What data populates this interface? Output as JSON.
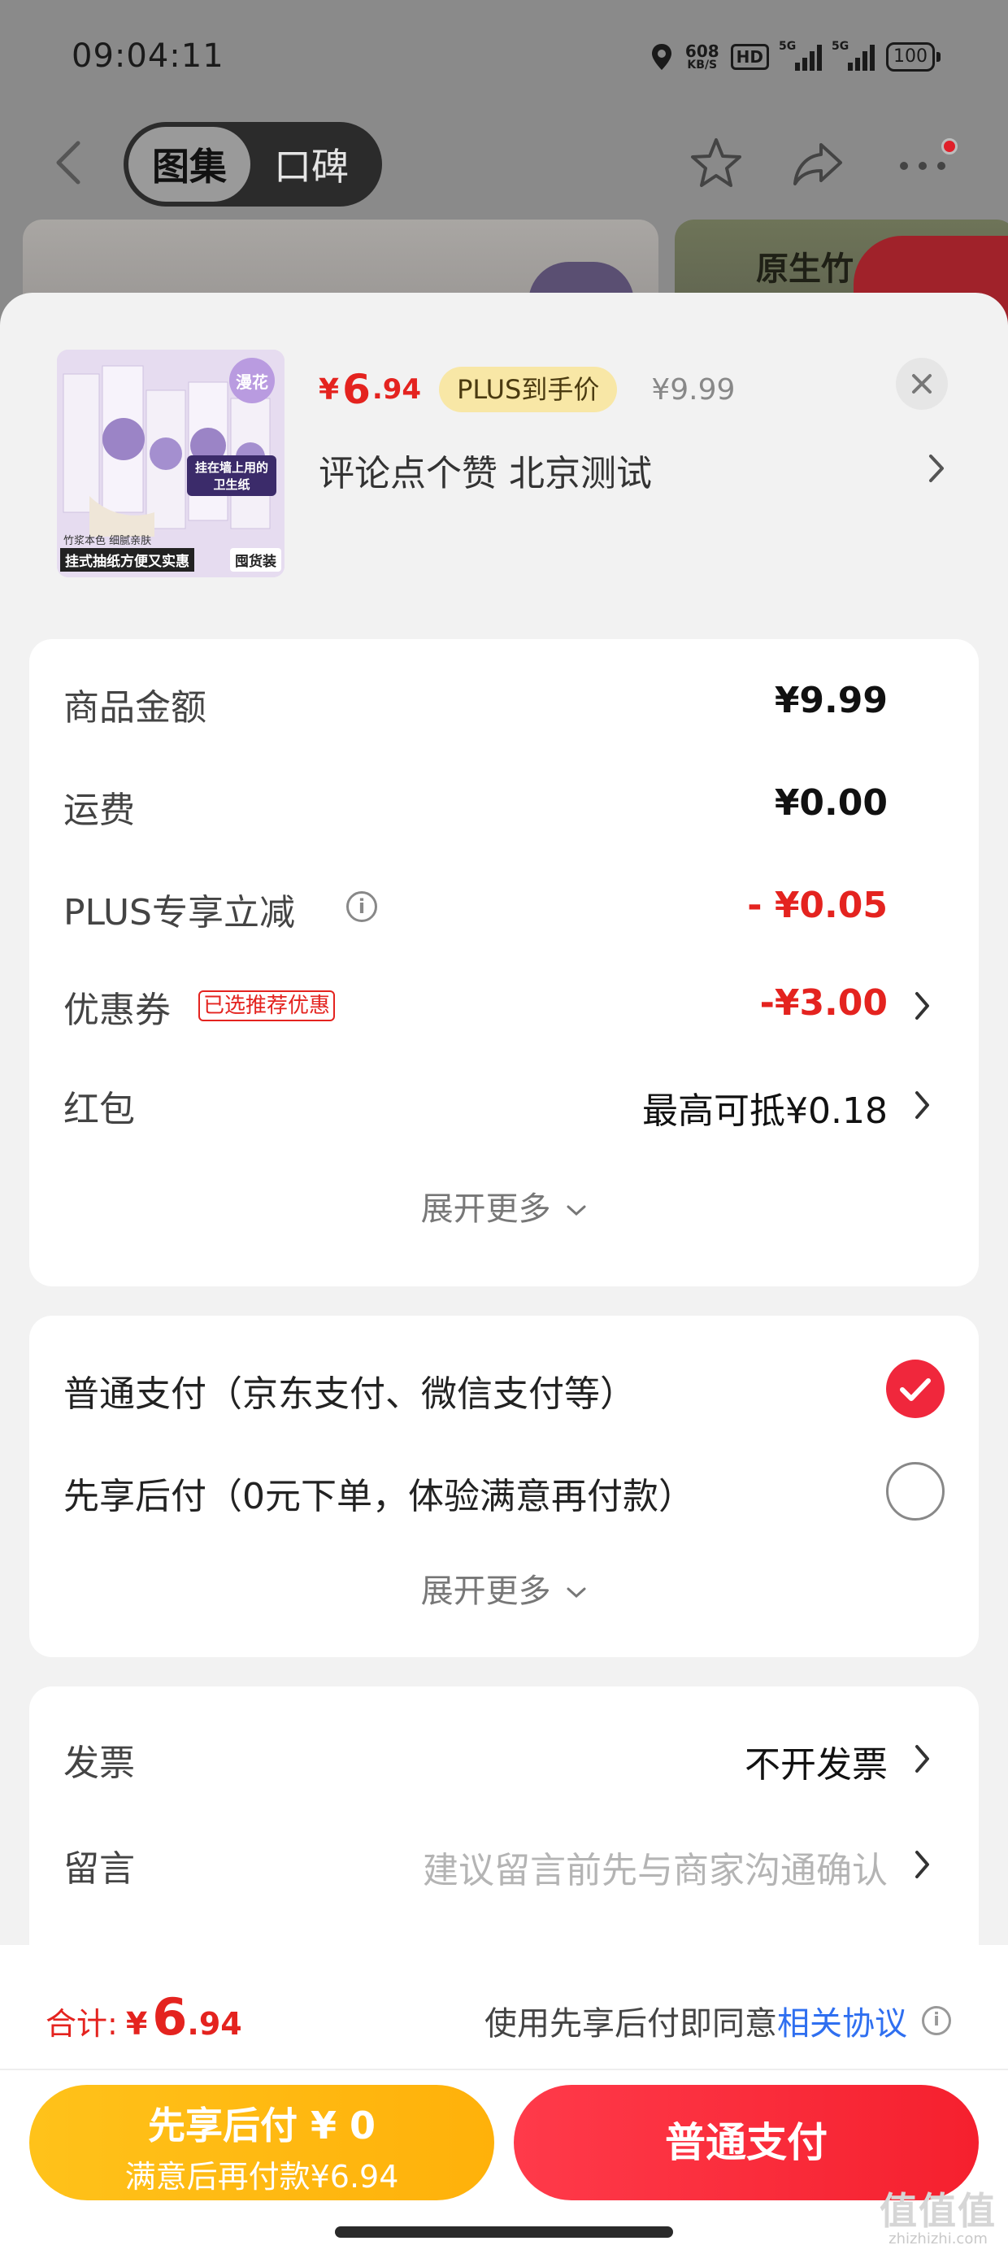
{
  "status_bar": {
    "time": "09:04:11",
    "net_speed": "608",
    "net_speed_unit": "KB/S",
    "hd": "HD",
    "sig1_tag": "5G",
    "sig2_tag": "5G",
    "battery": "100"
  },
  "nav": {
    "tabs": [
      {
        "label": "图集",
        "active": true
      },
      {
        "label": "口碑",
        "active": false
      }
    ]
  },
  "background": {
    "banner_text": "原生竹"
  },
  "product": {
    "thumb_badge": "漫花",
    "thumb_caption_1": "竹浆本色 细腻亲肤",
    "thumb_caption_2": "挂式抽纸方便又实惠",
    "thumb_caption_3": "囤货装",
    "thumb_sticker": "挂在墙上用的卫生纸",
    "price_currency": "¥",
    "price_int": "6",
    "price_dec": ".94",
    "plus_badge": "PLUS到手价",
    "original_price": "¥9.99",
    "title": "评论点个赞  北京测试"
  },
  "summary": {
    "rows": [
      {
        "label": "商品金额",
        "value": "¥9.99"
      },
      {
        "label": "运费",
        "value": "¥0.00"
      },
      {
        "label": "PLUS专享立减",
        "value": "- ¥0.05"
      },
      {
        "label": "优惠券",
        "tag": "已选推荐优惠",
        "value": "-¥3.00"
      },
      {
        "label": "红包",
        "value": "最高可抵¥0.18"
      }
    ],
    "expand_label": "展开更多"
  },
  "payment": {
    "options": [
      {
        "label": "普通支付（京东支付、微信支付等）",
        "selected": true
      },
      {
        "label": "先享后付（0元下单，体验满意再付款）",
        "selected": false
      }
    ],
    "expand_label": "展开更多"
  },
  "extras": {
    "invoice_label": "发票",
    "invoice_value": "不开发票",
    "message_label": "留言",
    "message_placeholder": "建议留言前先与商家沟通确认"
  },
  "footer": {
    "total_label": "合计:",
    "total_currency": "¥",
    "total_int": "6",
    "total_dec": ".94",
    "agree_text": "使用先享后付即同意",
    "agree_link": "相关协议",
    "bnpl_line1": "先享后付 ¥ 0",
    "bnpl_line2": "满意后再付款¥6.94",
    "pay_button": "普通支付"
  },
  "watermark": {
    "text": "值值值",
    "domain": "zhizhizhi.com"
  },
  "colors": {
    "accent_red": "#e4231f",
    "pay_button": "#f5202e",
    "bnpl_button": "#ffb10a",
    "plus_badge_bg": "#f8e7a6",
    "link_blue": "#2f6ff0"
  }
}
